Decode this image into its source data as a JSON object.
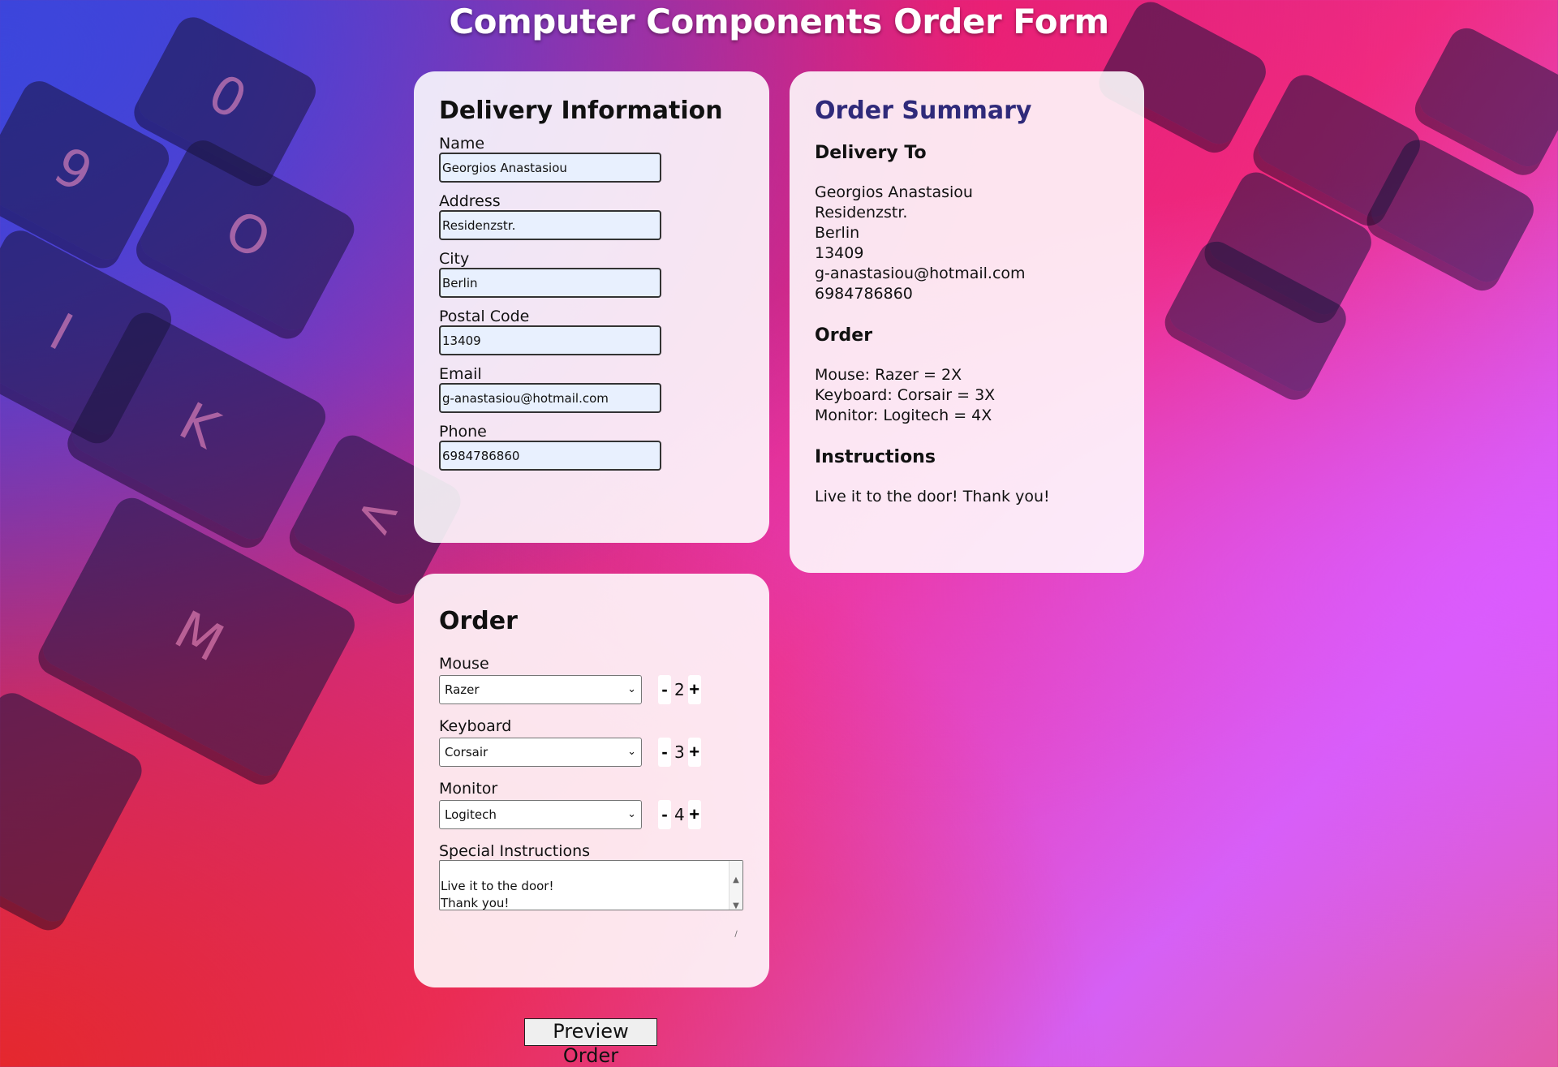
{
  "page": {
    "title": "Computer Components Order Form"
  },
  "background": {
    "key_letters": [
      "0",
      "9",
      "O",
      "I",
      "K",
      "M",
      "<"
    ]
  },
  "delivery": {
    "heading": "Delivery Information",
    "fields": [
      {
        "label": "Name",
        "value": "Georgios Anastasiou"
      },
      {
        "label": "Address",
        "value": "Residenzstr."
      },
      {
        "label": "City",
        "value": "Berlin"
      },
      {
        "label": "Postal Code",
        "value": "13409"
      },
      {
        "label": "Email",
        "value": "g-anastasiou@hotmail.com"
      },
      {
        "label": "Phone",
        "value": "6984786860"
      }
    ]
  },
  "summary": {
    "heading": "Order Summary",
    "delivery_to_heading": "Delivery To",
    "delivery_lines": [
      "Georgios Anastasiou",
      "Residenzstr.",
      "Berlin",
      "13409",
      "g-anastasiou@hotmail.com",
      "6984786860"
    ],
    "order_heading": "Order",
    "order_lines": [
      "Mouse: Razer = 2X",
      "Keyboard: Corsair = 3X",
      "Monitor: Logitech = 4X"
    ],
    "instructions_heading": "Instructions",
    "instructions_text": "Live it to the door! Thank you!"
  },
  "order": {
    "heading": "Order",
    "items": [
      {
        "label": "Mouse",
        "selected": "Razer",
        "quantity": "2"
      },
      {
        "label": "Keyboard",
        "selected": "Corsair",
        "quantity": "3"
      },
      {
        "label": "Monitor",
        "selected": "Logitech",
        "quantity": "4"
      }
    ],
    "minus_label": "-",
    "plus_label": "+",
    "instructions_label": "Special Instructions",
    "instructions_value": "Live it to the door!\nThank you!"
  },
  "preview_button": "Preview Order",
  "icons": {
    "dropdown": "chevron-down-icon",
    "scroll_up": "scroll-up-icon",
    "scroll_down": "scroll-down-icon",
    "resize": "resize-grip-icon"
  }
}
